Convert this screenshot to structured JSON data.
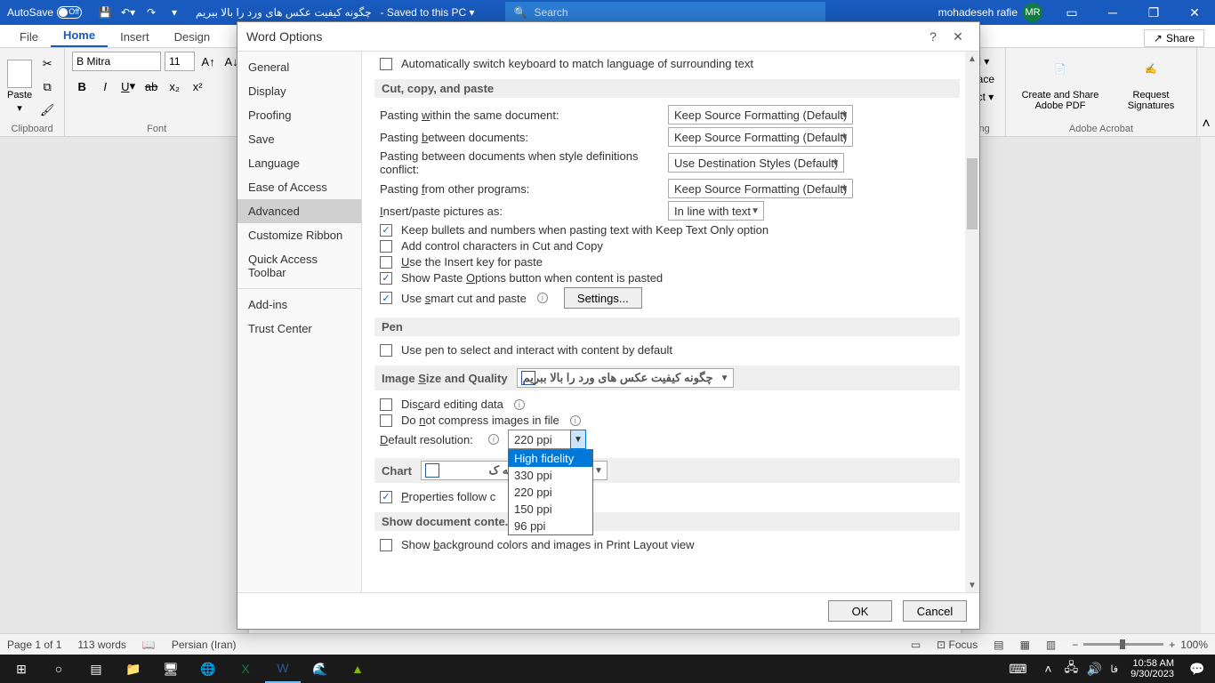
{
  "titlebar": {
    "autosave": "AutoSave",
    "autosave_state": "Off",
    "doc_title": "چگونه کیفیت عکس های ورد را بالا ببریم",
    "saved": "- Saved to this PC ▾",
    "search_placeholder": "Search",
    "user_name": "mohadeseh rafie",
    "user_initials": "MR"
  },
  "ribbon_tabs": {
    "file": "File",
    "home": "Home",
    "insert": "Insert",
    "design": "Design",
    "share": "Share"
  },
  "ribbon": {
    "paste": "Paste",
    "clipboard": "Clipboard",
    "font": "Font",
    "font_name": "B Mitra",
    "font_size": "11",
    "find": "Find ▾",
    "replace": "Replace",
    "select": "Select ▾",
    "editing": "Editing",
    "create_share": "Create and Share Adobe PDF",
    "request_sig": "Request Signatures",
    "adobe": "Adobe Acrobat"
  },
  "statusbar": {
    "page": "Page 1 of 1",
    "words": "113 words",
    "lang": "Persian (Iran)",
    "focus": "Focus",
    "zoom": "100%"
  },
  "taskbar": {
    "time": "10:58 AM",
    "date": "9/30/2023",
    "lang": "فا"
  },
  "dialog": {
    "title": "Word Options",
    "nav": {
      "general": "General",
      "display": "Display",
      "proofing": "Proofing",
      "save": "Save",
      "language": "Language",
      "ease": "Ease of Access",
      "advanced": "Advanced",
      "customize_ribbon": "Customize Ribbon",
      "qat": "Quick Access Toolbar",
      "addins": "Add-ins",
      "trust": "Trust Center"
    },
    "pane": {
      "auto_switch": "Automatically switch keyboard to match language of surrounding text",
      "cut_head": "Cut, copy, and paste",
      "paste_within": "Pasting within the same document:",
      "paste_between": "Pasting between documents:",
      "paste_between_conflict": "Pasting between documents when style definitions conflict:",
      "paste_other": "Pasting from other programs:",
      "insert_pictures": "Insert/paste pictures as:",
      "keep_source": "Keep Source Formatting (Default)",
      "use_dest": "Use Destination Styles (Default)",
      "inline": "In line with text",
      "keep_bullets": "Keep bullets and numbers when pasting text with Keep Text Only option",
      "add_control": "Add control characters in Cut and Copy",
      "use_insert_key": "Use the Insert key for paste",
      "show_paste_options": "Show Paste Options button when content is pasted",
      "use_smart_cut": "Use smart cut and paste",
      "settings_btn": "Settings...",
      "pen_head": "Pen",
      "use_pen": "Use pen to select and interact with content by default",
      "image_head": "Image Size and Quality",
      "doc_name": "چگونه کیفیت عکس های ورد را بالا ببریم",
      "discard_editing": "Discard editing data",
      "do_not_compress": "Do not compress images in file",
      "default_resolution": "Default resolution:",
      "res_value": "220 ppi",
      "res_options": {
        "high": "High fidelity",
        "r330": "330 ppi",
        "r220": "220 ppi",
        "r150": "150 ppi",
        "r96": "96 ppi"
      },
      "chart_head": "Chart",
      "chart_doc": "را بالا ببریم  چگونه ک",
      "properties_follow": "Properties follow c",
      "show_doc_head": "Show document conte...",
      "show_bg": "Show background colors and images in Print Layout view"
    },
    "buttons": {
      "ok": "OK",
      "cancel": "Cancel"
    }
  }
}
